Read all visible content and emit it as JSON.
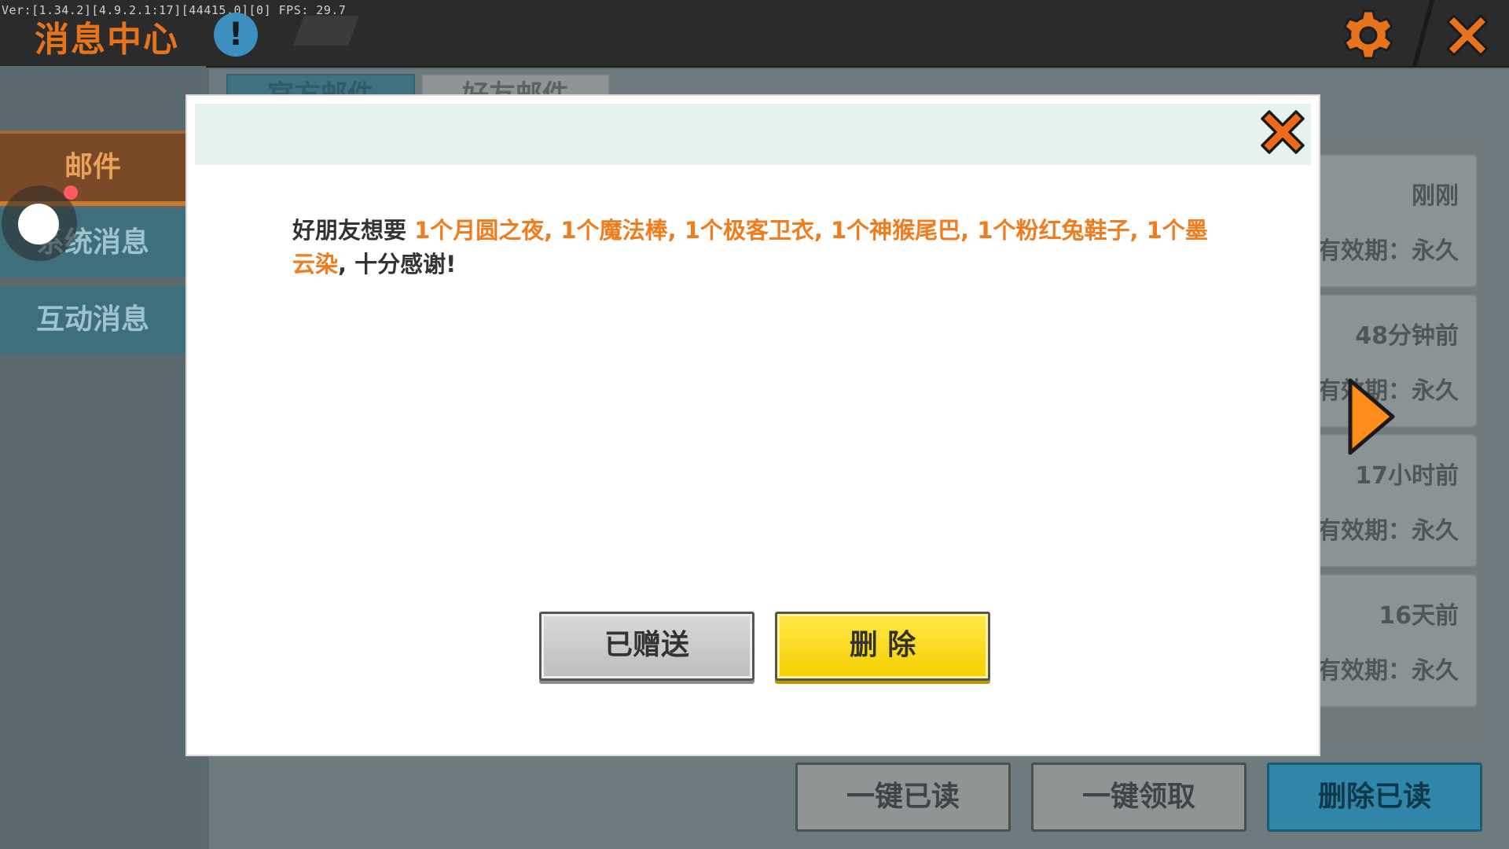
{
  "debug": {
    "version_text": "Ver:[1.34.2][4.9.2.1:17][44415,0][0] FPS: 29.7"
  },
  "header": {
    "title": "消息中心",
    "info_icon": "exclamation-icon",
    "settings_icon": "gear-icon",
    "close_icon": "close-icon"
  },
  "sidebar": {
    "items": [
      {
        "label": "邮件",
        "active": true
      },
      {
        "label": "系统消息",
        "active": false
      },
      {
        "label": "互动消息",
        "active": false
      }
    ]
  },
  "tabs": [
    {
      "label": "官方邮件",
      "active": true
    },
    {
      "label": "好友邮件",
      "active": false
    }
  ],
  "mail_list": [
    {
      "time": "刚刚",
      "expiry": "有效期：永久"
    },
    {
      "time": "48分钟前",
      "expiry": "有效期：永久"
    },
    {
      "time": "17小时前",
      "expiry": "有效期：永久"
    },
    {
      "time": "16天前",
      "expiry": "有效期：永久"
    }
  ],
  "bottom_buttons": {
    "read_all": "一键已读",
    "claim_all": "一键领取",
    "delete_read": "删除已读"
  },
  "modal": {
    "message_prefix": "好朋友想要 ",
    "message_items": "1个月圆之夜, 1个魔法棒, 1个极客卫衣, 1个神猴尾巴, 1个粉红兔鞋子, 1个墨云染",
    "message_suffix": ", 十分感谢!",
    "gifted_button": "已赠送",
    "delete_button": "删 除"
  },
  "colors": {
    "accent_orange": "#f07c1e",
    "delete_yellow": "#ffe000",
    "header_green": "#e6f3ec",
    "blue_button": "#2f86a8"
  }
}
